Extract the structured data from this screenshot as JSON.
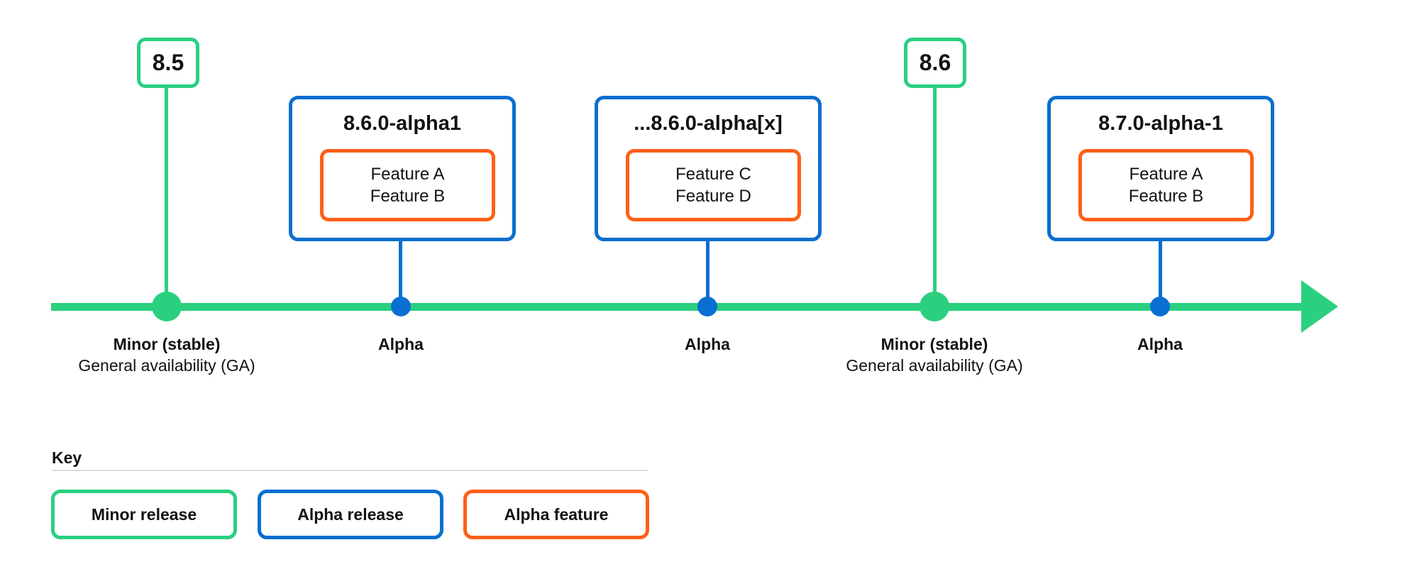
{
  "colors": {
    "minor_release": "#2AD07F",
    "alpha_release": "#0A6FD0",
    "alpha_feature": "#FF5F17",
    "divider": "#DCDCDC"
  },
  "timeline": {
    "direction": "left-to-right arrow",
    "milestones": [
      {
        "type": "minor",
        "version": "8.5",
        "label_bold": "Minor (stable)",
        "label_sub": "General availability (GA)"
      },
      {
        "type": "alpha",
        "version": "8.6.0-alpha1",
        "features": [
          "Feature A",
          "Feature B"
        ],
        "label_bold": "Alpha"
      },
      {
        "type": "alpha",
        "version": "...8.6.0-alpha[x]",
        "features": [
          "Feature C",
          "Feature D"
        ],
        "label_bold": "Alpha"
      },
      {
        "type": "minor",
        "version": "8.6",
        "label_bold": "Minor (stable)",
        "label_sub": "General availability (GA)"
      },
      {
        "type": "alpha",
        "version": "8.7.0-alpha-1",
        "features": [
          "Feature A",
          "Feature B"
        ],
        "label_bold": "Alpha"
      }
    ]
  },
  "key": {
    "title": "Key",
    "items": [
      {
        "label": "Minor release",
        "color": "#2AD07F"
      },
      {
        "label": "Alpha release",
        "color": "#0A6FD0"
      },
      {
        "label": "Alpha feature",
        "color": "#FF5F17"
      }
    ]
  }
}
